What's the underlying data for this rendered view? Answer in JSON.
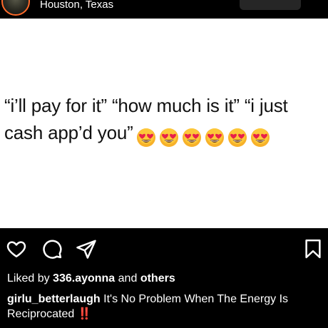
{
  "header": {
    "location": "Houston, Texas"
  },
  "post": {
    "tweet_text": "“i’ll pay for it” “how much is it” “i just cash app’d you”",
    "emoji": "heart-eyes-emoji",
    "emoji_count": 6
  },
  "actions": {
    "like_icon": "heart-icon",
    "comment_icon": "comment-icon",
    "share_icon": "send-icon",
    "save_icon": "bookmark-icon"
  },
  "likes": {
    "prefix": "Liked by",
    "user": "336.ayonna",
    "middle": "and",
    "others": "others"
  },
  "caption": {
    "username": "girlu_betterlaugh",
    "text": "It's No Problem When The Energy Is Reciprocated",
    "emoji": "‼️"
  },
  "colors": {
    "background": "#000000",
    "post_background": "#ffffff",
    "accent_red": "#e0243a"
  }
}
